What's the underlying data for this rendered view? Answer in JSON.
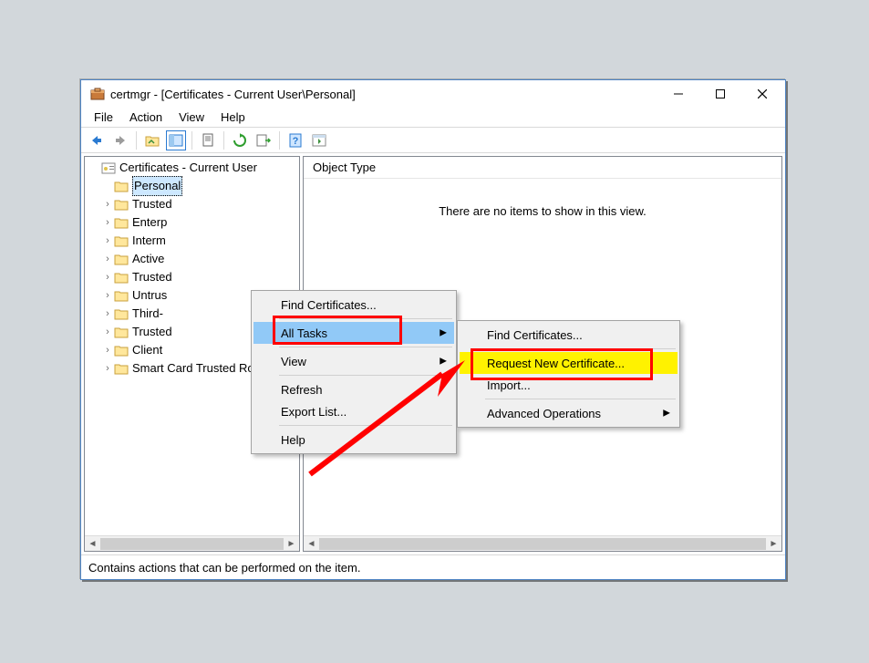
{
  "titlebar": {
    "title": "certmgr - [Certificates - Current User\\Personal]"
  },
  "menubar": {
    "file": "File",
    "action": "Action",
    "view": "View",
    "help": "Help"
  },
  "tree": {
    "root": "Certificates - Current User",
    "items": [
      "Personal",
      "Trusted",
      "Enterp",
      "Interm",
      "Active",
      "Trusted",
      "Untrus",
      "Third-",
      "Trusted",
      "Client",
      "Smart Card Trusted Roots"
    ]
  },
  "list": {
    "header": "Object Type",
    "empty": "There are no items to show in this view."
  },
  "statusbar": {
    "text": "Contains actions that can be performed on the item."
  },
  "ctx1": {
    "find": "Find Certificates...",
    "alltasks": "All Tasks",
    "view": "View",
    "refresh": "Refresh",
    "export": "Export List...",
    "help": "Help"
  },
  "ctx2": {
    "find": "Find Certificates...",
    "request": "Request New Certificate...",
    "import": "Import...",
    "advanced": "Advanced Operations"
  }
}
